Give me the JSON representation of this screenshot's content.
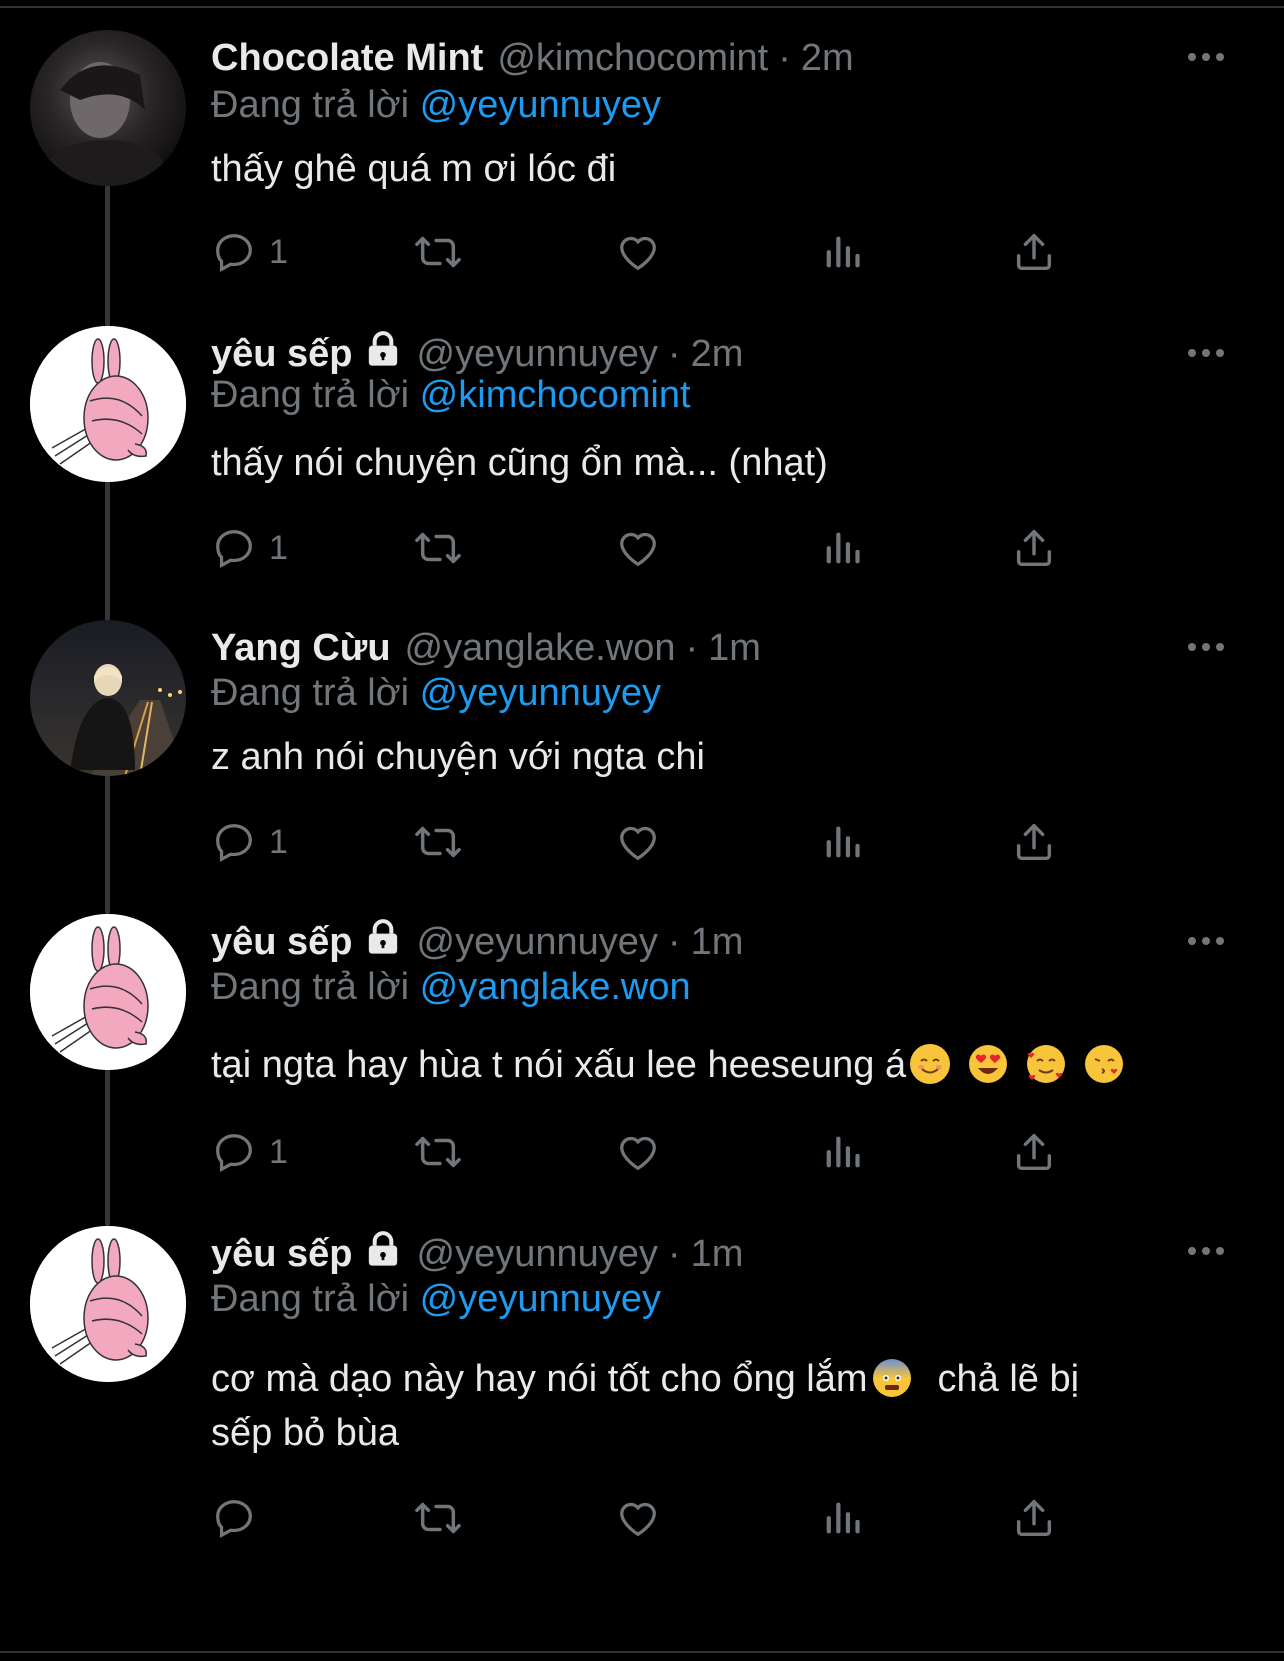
{
  "replying_prefix": "Đang trả lời",
  "tweets": [
    {
      "name": "Chocolate Mint",
      "handle": "@kimchocomint",
      "separator": "·",
      "time": "2m",
      "replying_to": "@yeyunnuyey",
      "text": "thấy ghê quá m ơi lóc đi",
      "reply_count": "1",
      "locked": false,
      "avatar": "photo-dark-portrait"
    },
    {
      "name": "yêu sếp",
      "handle": "@yeyunnuyey",
      "separator": "·",
      "time": "2m",
      "replying_to": "@kimchocomint",
      "text": "thấy nói chuyện cũng ổn mà... (nhạt)",
      "reply_count": "1",
      "locked": true,
      "avatar": "pink-bunny-drawing"
    },
    {
      "name": "Yang Cừu",
      "handle": "@yanglake.won",
      "separator": "·",
      "time": "1m",
      "replying_to": "@yeyunnuyey",
      "text": "z anh nói chuyện với ngta chi",
      "reply_count": "1",
      "locked": false,
      "avatar": "photo-night-highway"
    },
    {
      "name": "yêu sếp",
      "handle": "@yeyunnuyey",
      "separator": "·",
      "time": "1m",
      "replying_to": "@yanglake.won",
      "text": "tại ngta hay hùa t nói xấu lee heeseung á",
      "emojis": [
        "smiling-face-emoji",
        "heart-eyes-emoji",
        "smiling-face-with-hearts-emoji",
        "face-blowing-kiss-emoji"
      ],
      "reply_count": "1",
      "locked": true,
      "avatar": "pink-bunny-drawing"
    },
    {
      "name": "yêu sếp",
      "handle": "@yeyunnuyey",
      "separator": "·",
      "time": "1m",
      "replying_to": "@yeyunnuyey",
      "text_line1_a": "cơ mà dạo này hay nói tốt cho ổng lắm",
      "text_line1_b": "chả lẽ bị",
      "text_line2": "sếp bỏ bùa",
      "emojis": [
        "anxious-face-emoji"
      ],
      "reply_count": "",
      "locked": true,
      "avatar": "pink-bunny-drawing"
    }
  ],
  "icons": {
    "reply": "reply-icon",
    "retweet": "retweet-icon",
    "like": "like-icon",
    "views": "views-icon",
    "share": "share-icon",
    "more": "more-icon",
    "lock": "lock-icon"
  },
  "colors": {
    "background": "#000000",
    "text": "#e7e9ea",
    "muted": "#71767b",
    "mention": "#1d9bf0",
    "thread_line": "#333639"
  }
}
